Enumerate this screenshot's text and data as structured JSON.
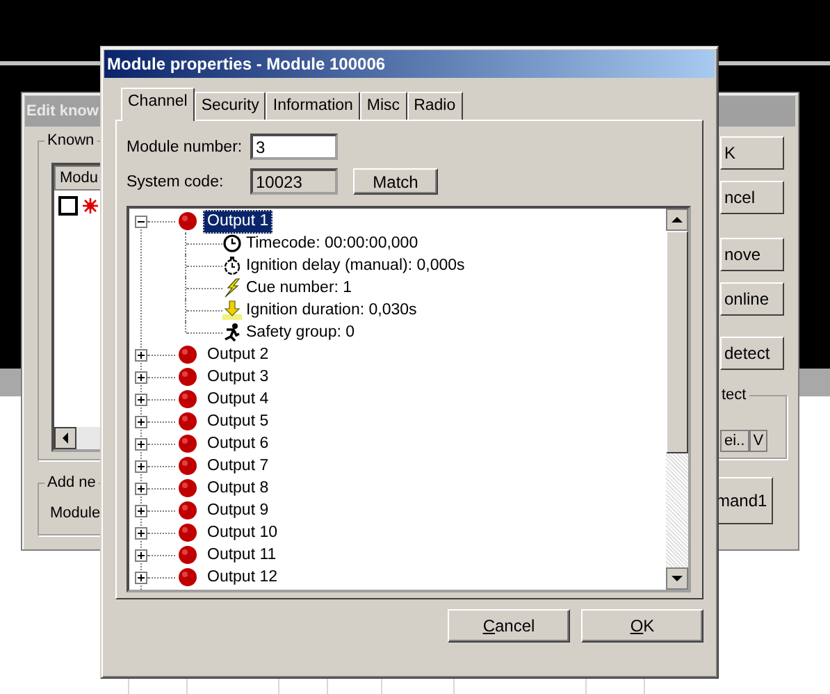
{
  "back_dialog": {
    "title": "Edit know",
    "known_group": {
      "label": "Known",
      "column": "Modu",
      "rows": [
        {
          "checked": false
        }
      ]
    },
    "add_group": {
      "label": "Add ne",
      "field_label": "Module"
    },
    "buttons": [
      "K",
      "ncel",
      "nove",
      "online",
      "detect"
    ],
    "detect_group": "tect",
    "command_button": "mand1"
  },
  "back_table": {
    "column_headers": [
      "ei..",
      "V"
    ]
  },
  "dialog": {
    "title": "Module properties - Module 100006",
    "tabs": [
      {
        "label": "Channel",
        "selected": true
      },
      {
        "label": "Security",
        "selected": false
      },
      {
        "label": "Information",
        "selected": false
      },
      {
        "label": "Misc",
        "selected": false
      },
      {
        "label": "Radio",
        "selected": false
      }
    ],
    "module_number": {
      "label": "Module number:",
      "value": "3"
    },
    "system_code": {
      "label": "System code:",
      "value": "10023",
      "disabled": true
    },
    "match_button": "Match",
    "tree": [
      {
        "label": "Output 1",
        "selected": true,
        "expanded": true,
        "children": [
          {
            "kind": "timecode",
            "label": "Timecode: 00:00:00,000"
          },
          {
            "kind": "delay",
            "label": "Ignition delay (manual): 0,000s"
          },
          {
            "kind": "cue",
            "label": "Cue number: 1"
          },
          {
            "kind": "duration",
            "label": "Ignition duration: 0,030s"
          },
          {
            "kind": "safety",
            "label": "Safety group: 0"
          }
        ]
      },
      {
        "label": "Output 2",
        "selected": false,
        "expanded": false
      },
      {
        "label": "Output 3",
        "selected": false,
        "expanded": false
      },
      {
        "label": "Output 4",
        "selected": false,
        "expanded": false
      },
      {
        "label": "Output 5",
        "selected": false,
        "expanded": false
      },
      {
        "label": "Output 6",
        "selected": false,
        "expanded": false
      },
      {
        "label": "Output 7",
        "selected": false,
        "expanded": false
      },
      {
        "label": "Output 8",
        "selected": false,
        "expanded": false
      },
      {
        "label": "Output 9",
        "selected": false,
        "expanded": false
      },
      {
        "label": "Output 10",
        "selected": false,
        "expanded": false
      },
      {
        "label": "Output 11",
        "selected": false,
        "expanded": false
      },
      {
        "label": "Output 12",
        "selected": false,
        "expanded": false
      }
    ],
    "buttons": [
      {
        "label": "Cancel",
        "mnemonic": true
      },
      {
        "label": "OK",
        "mnemonic": true
      }
    ]
  }
}
